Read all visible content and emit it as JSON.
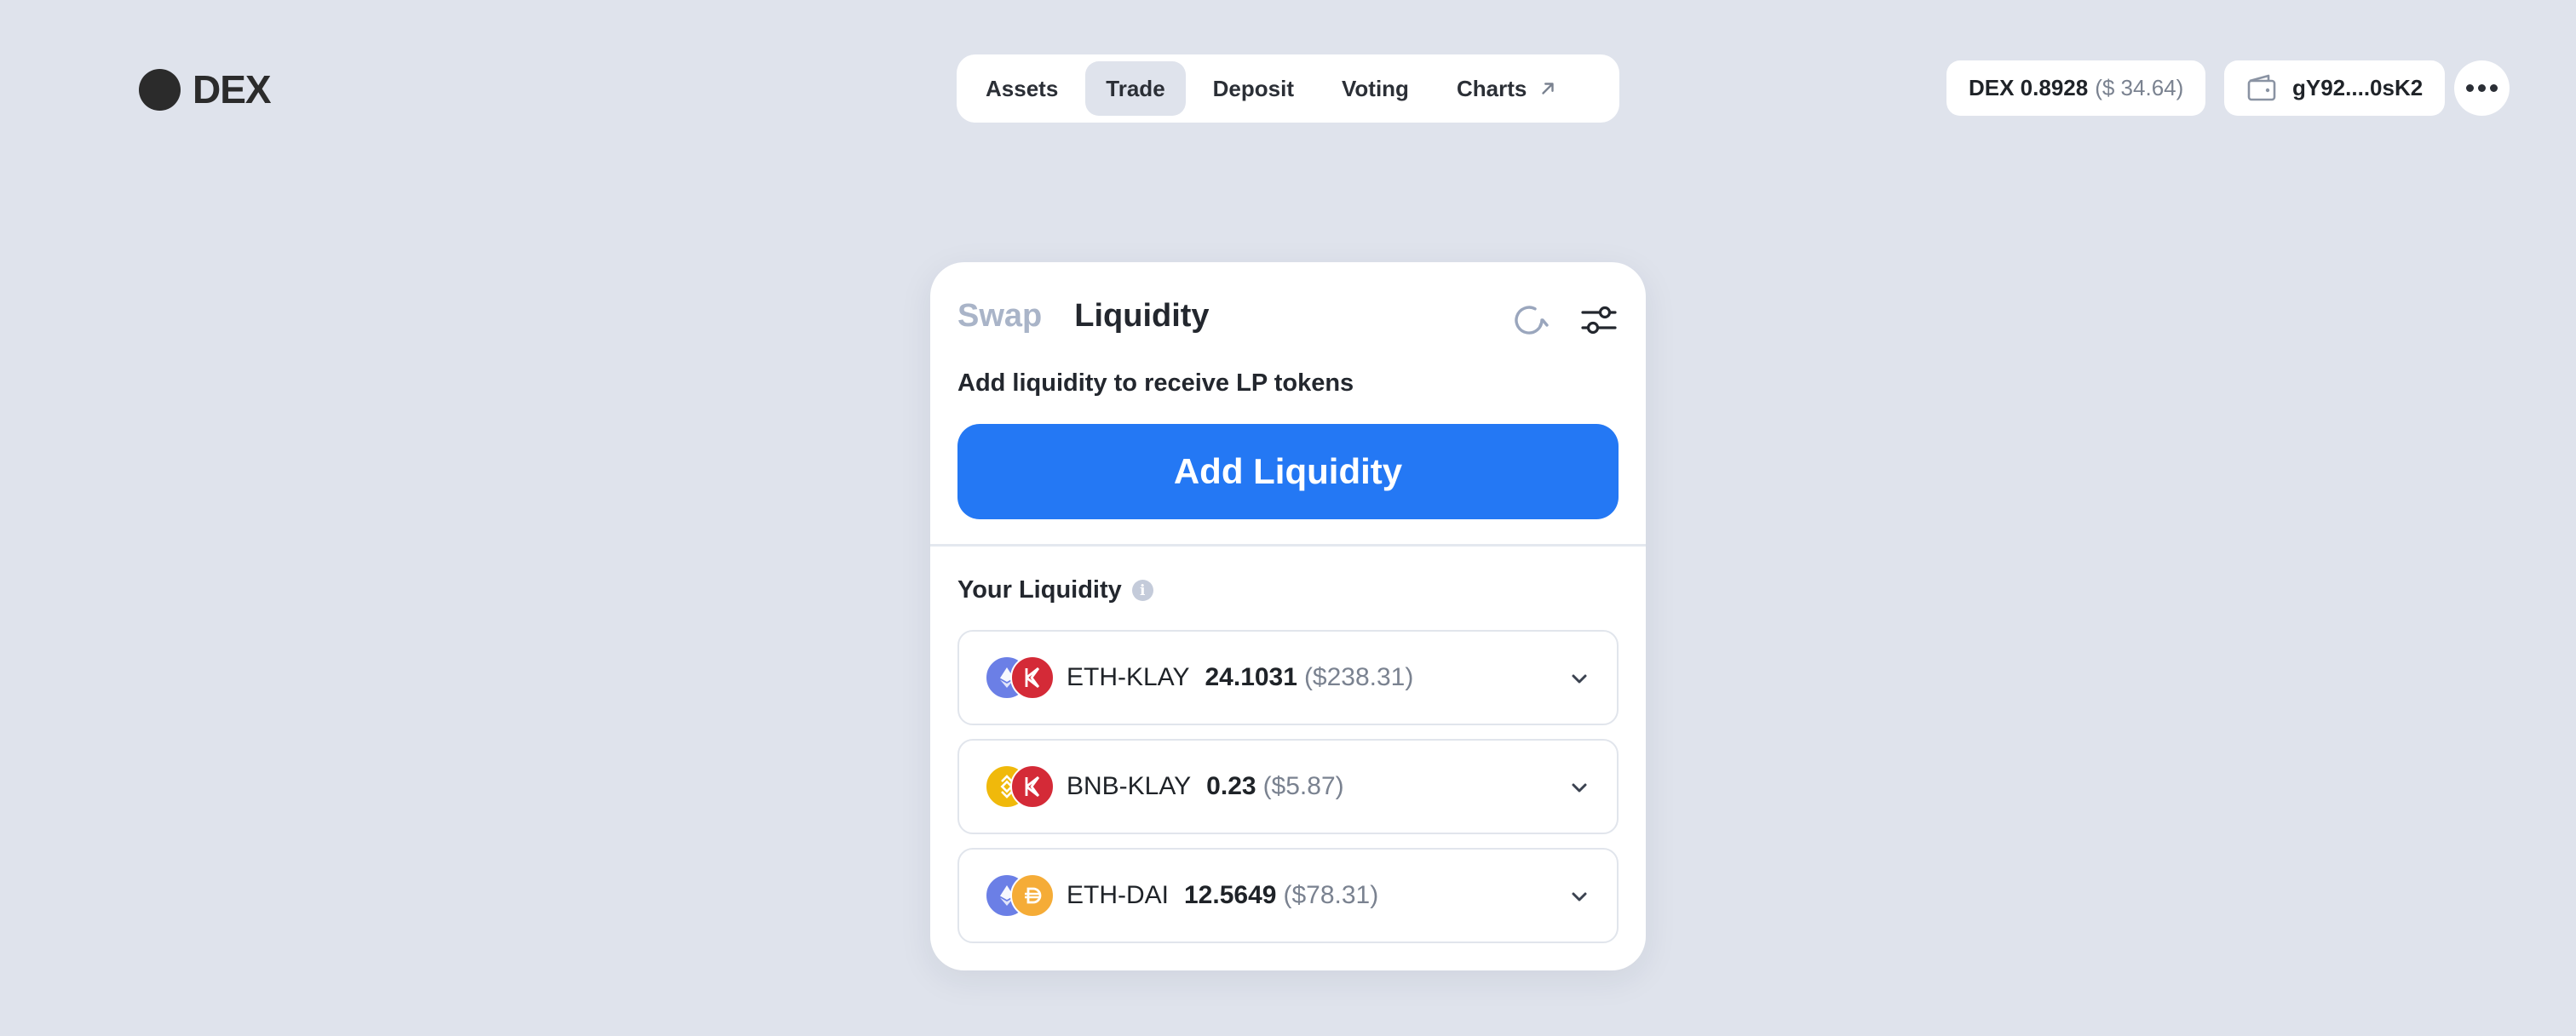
{
  "header": {
    "logo_text": "DEX",
    "nav": [
      {
        "label": "Assets",
        "active": false
      },
      {
        "label": "Trade",
        "active": true
      },
      {
        "label": "Deposit",
        "active": false
      },
      {
        "label": "Voting",
        "active": false
      },
      {
        "label": "Charts",
        "active": false,
        "external": true
      }
    ],
    "dex_price": {
      "label": "DEX 0.8928",
      "usd": "($ 34.64)"
    },
    "wallet": {
      "address": "gY92....0sK2",
      "icon": "wallet-icon"
    },
    "more_icon": "more-icon"
  },
  "card": {
    "tabs": [
      {
        "label": "Swap",
        "active": false
      },
      {
        "label": "Liquidity",
        "active": true
      }
    ],
    "subtitle": "Add liquidity to receive LP tokens",
    "primary_button": "Add Liquidity",
    "your_liquidity_label": "Your Liquidity",
    "info_icon_glyph": "i",
    "pools": [
      {
        "name": "ETH-KLAY",
        "amount": "24.1031",
        "usd": "($238.31)",
        "tokens": [
          "eth",
          "klay"
        ]
      },
      {
        "name": "BNB-KLAY",
        "amount": "0.23",
        "usd": "($5.87)",
        "tokens": [
          "bnb",
          "klay"
        ]
      },
      {
        "name": "ETH-DAI",
        "amount": "12.5649",
        "usd": "($78.31)",
        "tokens": [
          "eth",
          "dai"
        ]
      }
    ]
  },
  "colors": {
    "background": "#dfe3ec",
    "accent": "#2478f4",
    "eth": "#6b7fe6",
    "klay": "#d42a37",
    "bnb": "#f0b90b",
    "dai": "#f5ac37"
  }
}
